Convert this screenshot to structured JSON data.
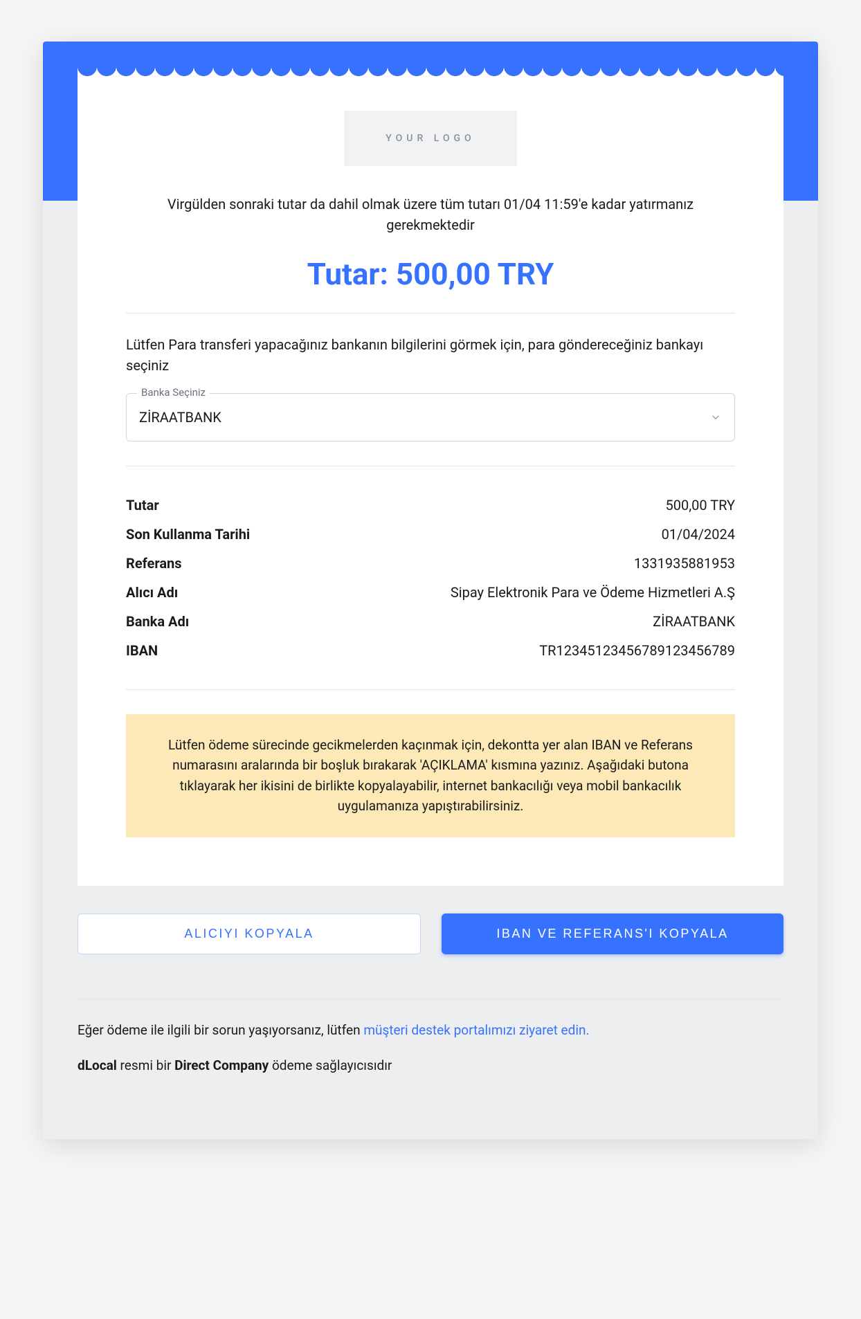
{
  "logo": {
    "placeholder": "YOUR LOGO"
  },
  "instruction": "Virgülden sonraki tutar da dahil olmak üzere tüm tutarı 01/04 11:59'e kadar yatırmanız gerekmektedir",
  "amount": {
    "label": "Tutar:",
    "value": "500,00 TRY"
  },
  "bankSelectText": "Lütfen Para transferi yapacağınız bankanın bilgilerini görmek için, para göndereceğiniz bankayı seçiniz",
  "bankSelect": {
    "label": "Banka Seçiniz",
    "selected": "ZİRAATBANK"
  },
  "details": {
    "amount": {
      "label": "Tutar",
      "value": "500,00 TRY"
    },
    "expiry": {
      "label": "Son Kullanma Tarihi",
      "value": "01/04/2024"
    },
    "reference": {
      "label": "Referans",
      "value": "1331935881953"
    },
    "recipient": {
      "label": "Alıcı Adı",
      "value": "Sipay Elektronik Para ve Ödeme Hizmetleri A.Ş"
    },
    "bankName": {
      "label": "Banka Adı",
      "value": "ZİRAATBANK"
    },
    "iban": {
      "label": "IBAN",
      "value": "TR12345123456789123456789"
    }
  },
  "warning": "Lütfen ödeme sürecinde gecikmelerden kaçınmak için, dekontta yer alan IBAN ve Referans numarasını aralarında bir boşluk bırakarak 'AÇIKLAMA' kısmına yazınız. Aşağıdaki butona tıklayarak her ikisini de birlikte kopyalayabilir, internet bankacılığı veya mobil bankacılık uygulamanıza yapıştırabilirsiniz.",
  "buttons": {
    "copyRecipient": "ALICIYI KOPYALA",
    "copyIbanRef": "IBAN VE REFERANS'I KOPYALA"
  },
  "footer": {
    "supportPrefix": "Eğer ödeme ile ilgili bir sorun yaşıyorsanız, lütfen ",
    "supportLink": "müşteri destek portalımızı ziyaret edin.",
    "provider": {
      "brand1": "dLocal",
      "mid": " resmi bir ",
      "brand2": "Direct Company",
      "suffix": " ödeme sağlayıcısıdır"
    }
  }
}
